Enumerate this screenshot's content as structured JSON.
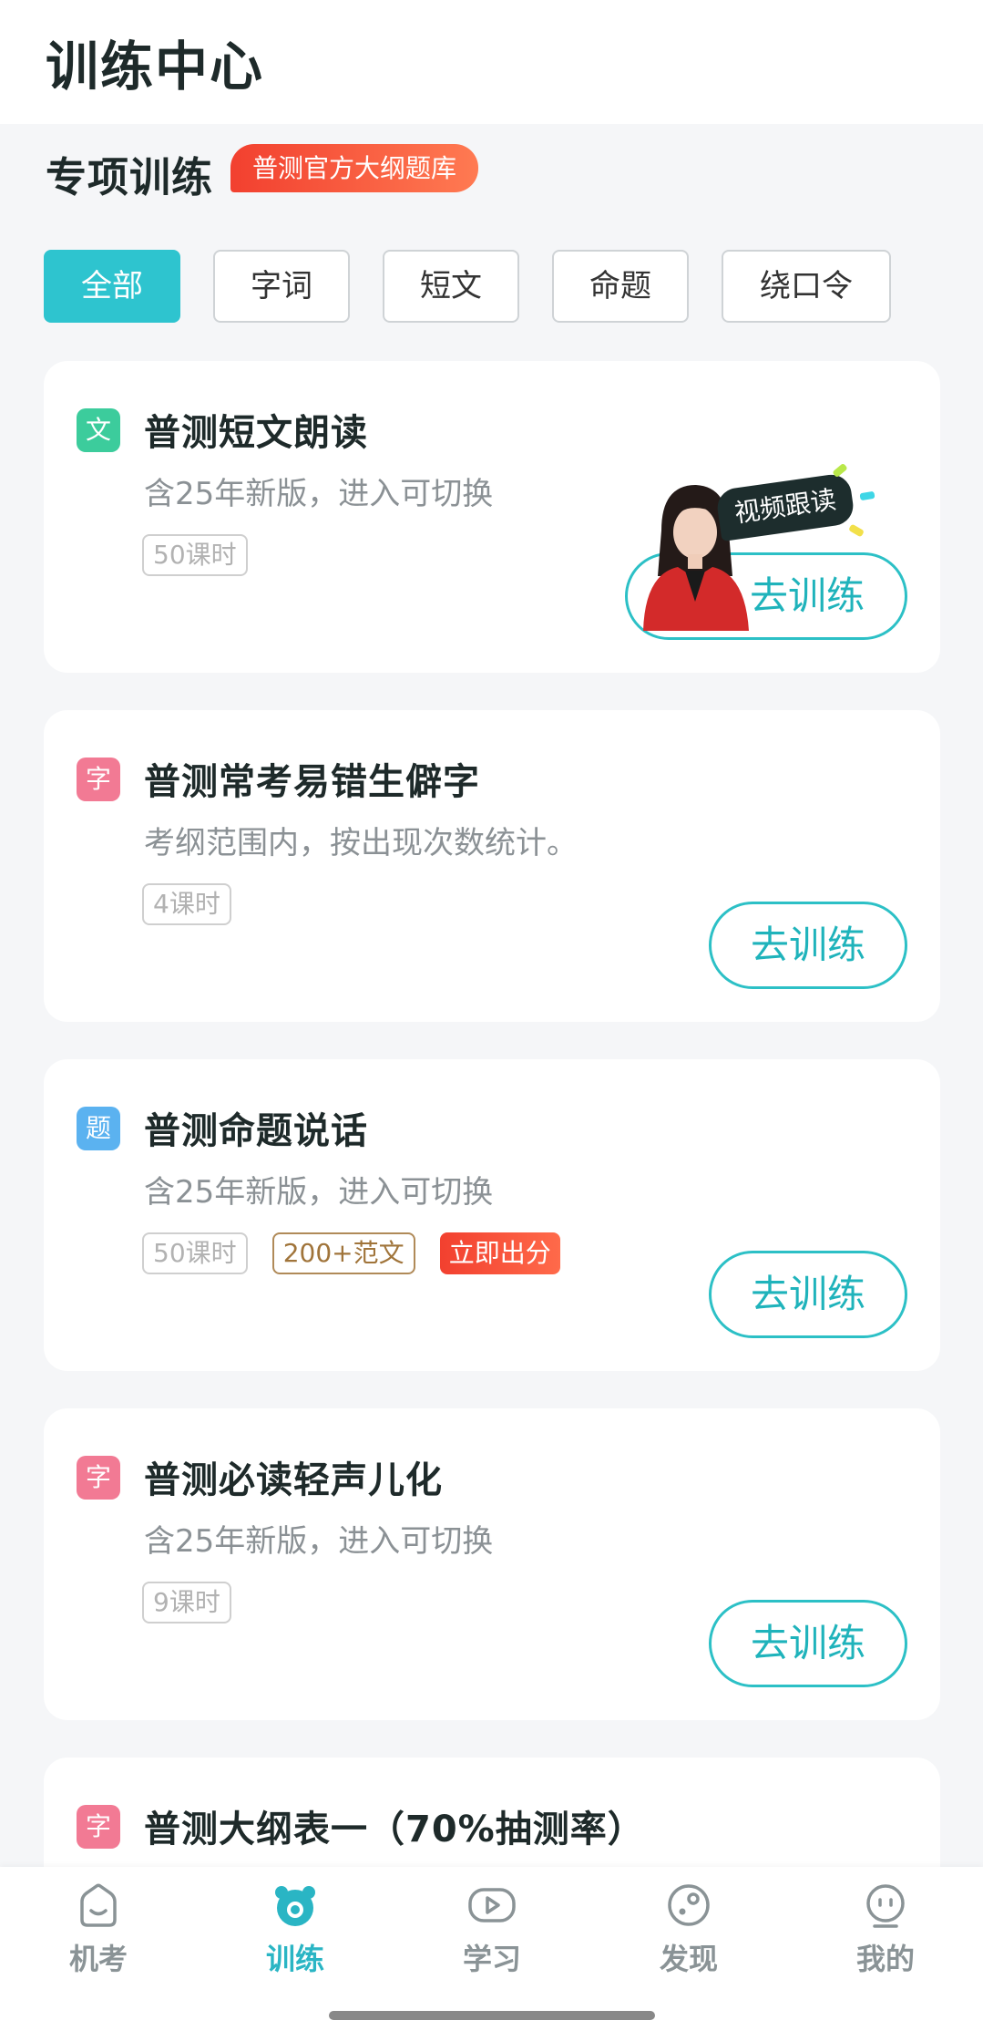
{
  "header": {
    "title": "训练中心"
  },
  "section": {
    "title": "专项训练",
    "badge": "普测官方大纲题库"
  },
  "filters": [
    {
      "label": "全部",
      "active": true
    },
    {
      "label": "字词",
      "active": false
    },
    {
      "label": "短文",
      "active": false
    },
    {
      "label": "命题",
      "active": false
    },
    {
      "label": "绕口令",
      "active": false
    }
  ],
  "cards": [
    {
      "cat": "文",
      "title": "普测短文朗读",
      "subtitle": "含25年新版，进入可切换",
      "tags": [
        "50课时"
      ],
      "video_label": "视频跟读",
      "button": "去训练"
    },
    {
      "cat": "字",
      "title": "普测常考易错生僻字",
      "subtitle": "考纲范围内，按出现次数统计。",
      "tags": [
        "4课时"
      ],
      "button": "去训练"
    },
    {
      "cat": "题",
      "title": "普测命题说话",
      "subtitle": "含25年新版，进入可切换",
      "tags": [
        "50课时",
        "200+范文",
        "立即出分"
      ],
      "button": "去训练"
    },
    {
      "cat": "字",
      "title": "普测必读轻声儿化",
      "subtitle": "含25年新版，进入可切换",
      "tags": [
        "9课时"
      ],
      "button": "去训练"
    },
    {
      "cat": "字",
      "title": "普测大纲表一（70%抽测率）"
    }
  ],
  "tabbar": [
    {
      "label": "机考",
      "icon": "exam-house-icon",
      "active": false
    },
    {
      "label": "训练",
      "icon": "train-bear-icon",
      "active": true
    },
    {
      "label": "学习",
      "icon": "play-video-icon",
      "active": false
    },
    {
      "label": "发现",
      "icon": "discover-planet-icon",
      "active": false
    },
    {
      "label": "我的",
      "icon": "profile-face-icon",
      "active": false
    }
  ],
  "colors": {
    "accent": "#2ec4cf",
    "badge_red": "#f2402f",
    "title": "#1e2a2a",
    "muted": "#8b9195"
  }
}
